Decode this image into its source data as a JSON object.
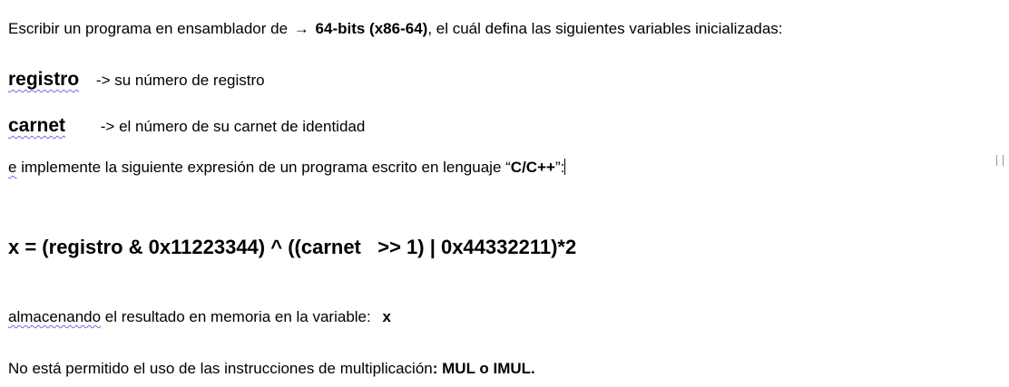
{
  "intro": {
    "prefix": "Escribir un programa en ensamblador de",
    "arrow": "→",
    "arch": "64-bits (x86-64)",
    "suffix": ", el cuál defina las siguientes variables inicializadas:"
  },
  "variables": [
    {
      "name": "registro",
      "description": "-> su número de registro"
    },
    {
      "name": "carnet",
      "description": "-> el número de su carnet de identidad"
    }
  ],
  "implement": {
    "e": "e",
    "text": " implemente la siguiente expresión de un programa escrito en lenguaje “",
    "lang": "C/C++",
    "end": "”:"
  },
  "formula": "x = (registro & 0x11223344) ^ ((carnet   >> 1) | 0x44332211)*2",
  "store": {
    "word": "almacenando",
    "text": " el resultado en memoria en la variable:",
    "var": "x"
  },
  "restriction": {
    "text": "No está permitido el uso de las instrucciones de multiplicación",
    "colon": ":",
    "instr": " MUL o IMUL."
  }
}
